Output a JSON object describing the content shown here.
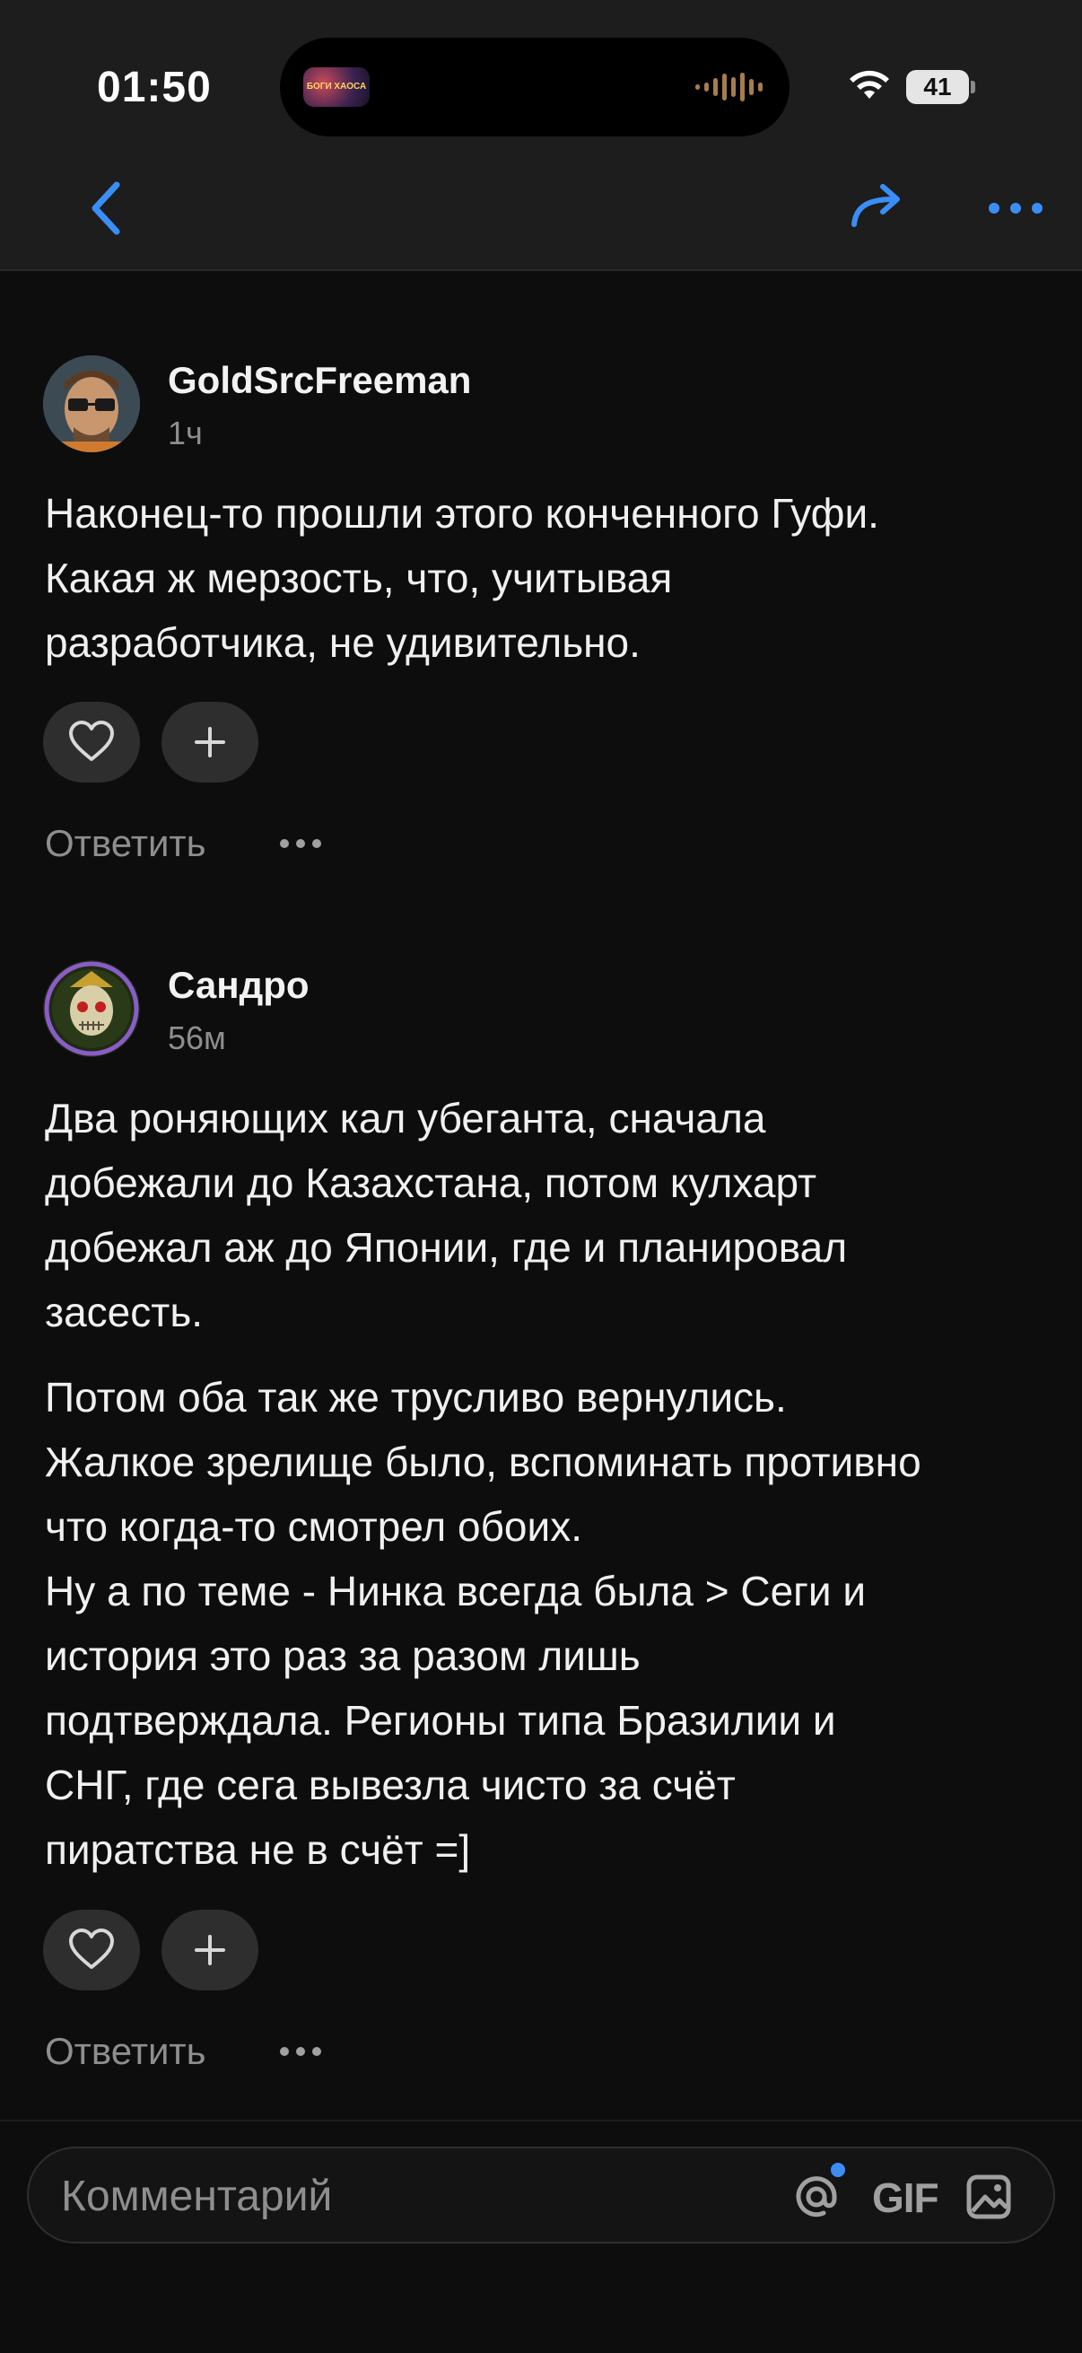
{
  "status_bar": {
    "time": "01:50",
    "island_label": "БОГИ ХАОСА",
    "battery": "41"
  },
  "nav": {
    "back_icon": "chevron-left-icon",
    "share_icon": "share-arrow-icon",
    "more_icon": "more-horizontal-icon",
    "accent_color": "#3a8ef6"
  },
  "comments": [
    {
      "author": "GoldSrcFreeman",
      "time": "1ч",
      "paragraphs": [
        "Наконец-то прошли этого конченного Гуфи.\nКакая ж мерзость, что, учитывая\nразработчика, не удивительно."
      ],
      "reply_label": "Ответить"
    },
    {
      "author": "Сандро",
      "time": "56м",
      "paragraphs": [
        "Два роняющих кал убеганта, сначала\nдобежали до Казахстана, потом кулхарт\nдобежал аж до Японии, где и планировал\nзасесть.",
        "Потом оба так же трусливо вернулись.\nЖалкое зрелище было, вспоминать противно\nчто когда-то смотрел обоих.\nНу а по теме - Нинка всегда была > Сеги и\nистория это раз за разом лишь\nподтверждала. Регионы типа Бразилии и\nСНГ, где сега вывезла чисто за счёт\nпиратства не в счёт =]"
      ],
      "reply_label": "Ответить"
    }
  ],
  "composer": {
    "placeholder": "Комментарий",
    "gif_label": "GIF"
  }
}
